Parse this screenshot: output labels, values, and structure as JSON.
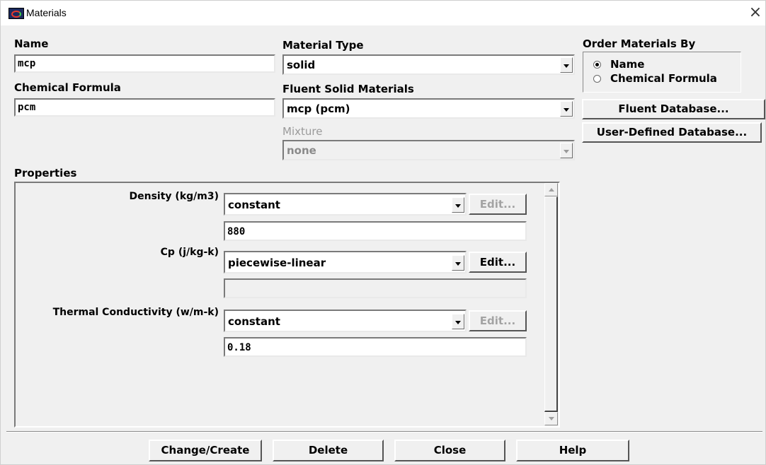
{
  "window": {
    "title": "Materials",
    "close_glyph": "×"
  },
  "name": {
    "label": "Name",
    "value": "mcp"
  },
  "chemical_formula": {
    "label": "Chemical Formula",
    "value": "pcm"
  },
  "material_type": {
    "label": "Material Type",
    "value": "solid"
  },
  "fluent_solid_materials": {
    "label": "Fluent Solid Materials",
    "value": "mcp (pcm)"
  },
  "mixture": {
    "label": "Mixture",
    "value": "none",
    "enabled": false
  },
  "order_by": {
    "label": "Order Materials By",
    "options": [
      {
        "label": "Name",
        "selected": true
      },
      {
        "label": "Chemical Formula",
        "selected": false
      }
    ]
  },
  "database_buttons": {
    "fluent": "Fluent Database...",
    "user_defined": "User-Defined Database..."
  },
  "properties": {
    "label": "Properties",
    "rows": [
      {
        "label": "Density (kg/m3)",
        "method": "constant",
        "edit_label": "Edit...",
        "edit_enabled": false,
        "value": "880"
      },
      {
        "label": "Cp (j/kg-k)",
        "method": "piecewise-linear",
        "edit_label": "Edit...",
        "edit_enabled": true,
        "value": ""
      },
      {
        "label": "Thermal Conductivity (w/m-k)",
        "method": "constant",
        "edit_label": "Edit...",
        "edit_enabled": false,
        "value": "0.18"
      }
    ]
  },
  "bottom_buttons": {
    "change_create": "Change/Create",
    "delete": "Delete",
    "close": "Close",
    "help": "Help"
  }
}
